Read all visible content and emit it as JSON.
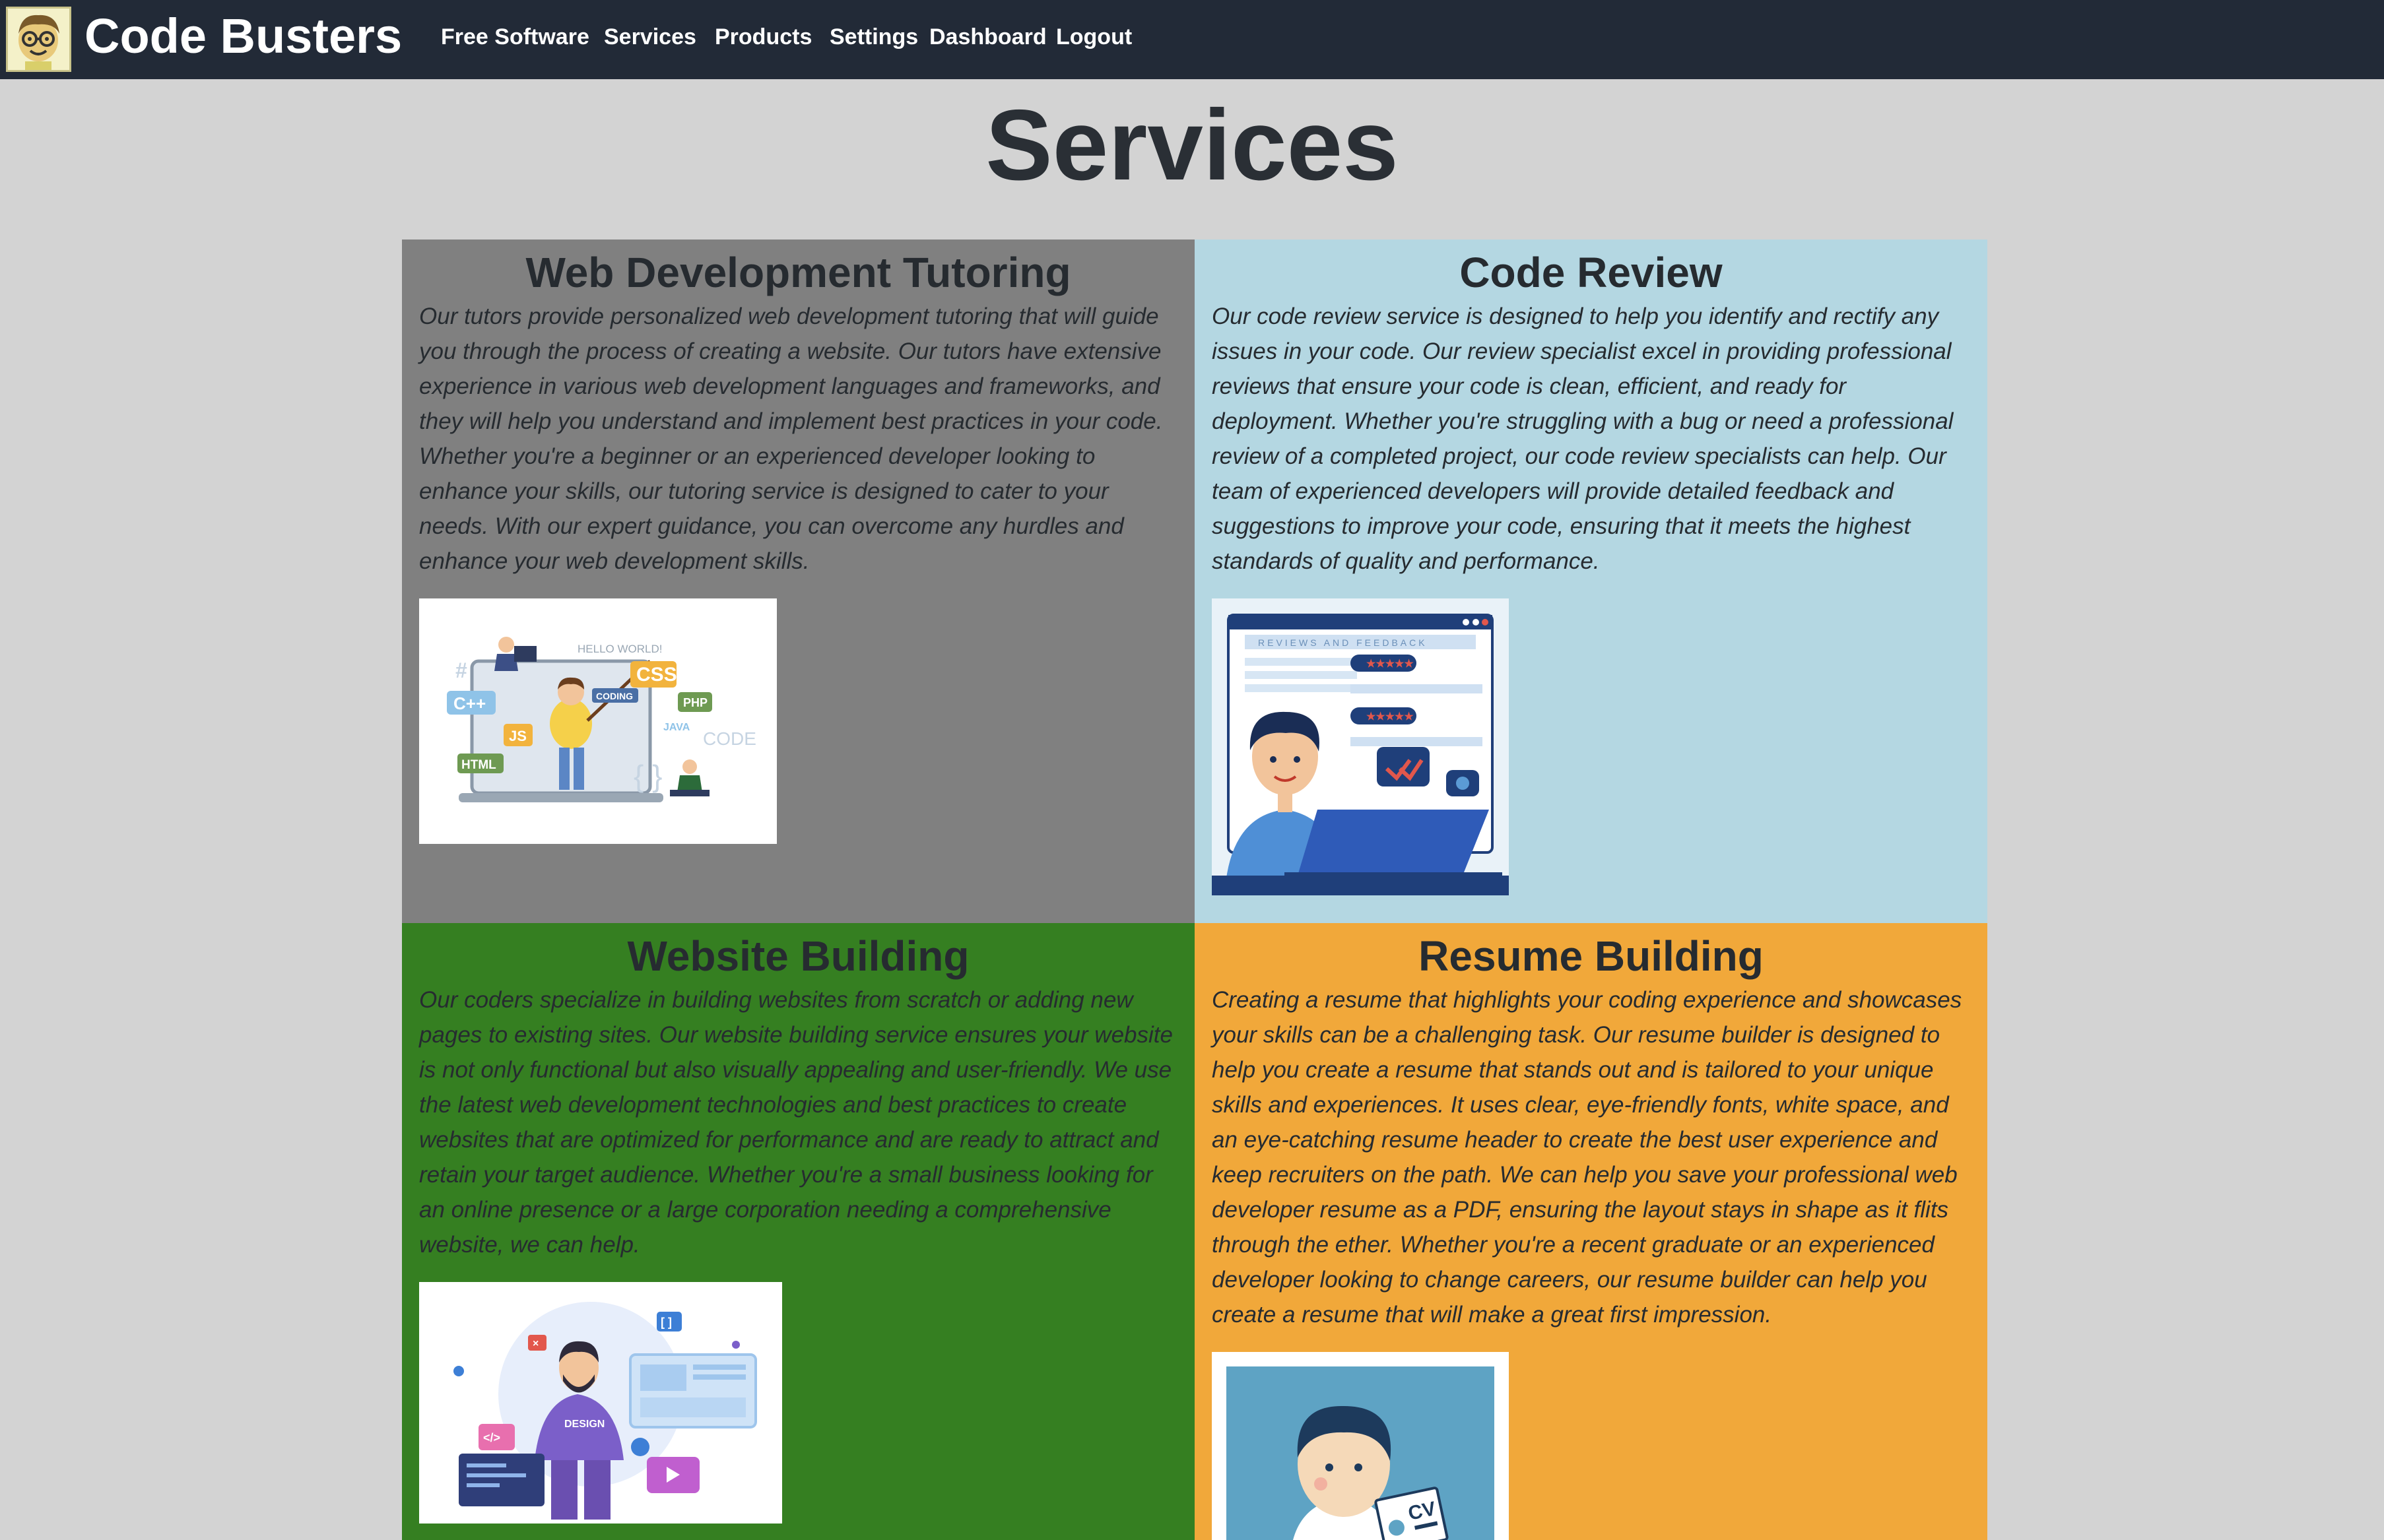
{
  "brand": {
    "name": "Code Busters",
    "logo_icon": "nerd-face-icon"
  },
  "nav": {
    "items": [
      "Free Software",
      "Services",
      "Products",
      "Settings",
      "Dashboard",
      "Logout"
    ]
  },
  "page": {
    "title": "Services"
  },
  "cards": [
    {
      "title": "Web Development Tutoring",
      "text": "Our tutors provide personalized web development tutoring that will guide you through the process of creating a website. Our tutors have extensive experience in various web development languages and frameworks, and they will help you understand and implement best practices in your code. Whether you're a beginner or an experienced developer looking to enhance your skills, our tutoring service is designed to cater to your needs. With our expert guidance, you can overcome any hurdles and enhance your web development skills.",
      "background": "#808080",
      "image_labels": [
        "HELLO WORLD!",
        "C++",
        "CSS",
        "CODING",
        "PHP",
        "JS",
        "JAVA",
        "CODE",
        "HTML",
        "{ }",
        "#"
      ]
    },
    {
      "title": "Code Review",
      "text": "Our code review service is designed to help you identify and rectify any issues in your code. Our review specialist excel in providing professional reviews that ensure your code is clean, efficient, and ready for deployment. Whether you're struggling with a bug or need a professional review of a completed project, our code review specialists can help. Our team of experienced developers will provide detailed feedback and suggestions to improve your code, ensuring that it meets the highest standards of quality and performance.",
      "background": "#b4d7e2",
      "image_labels": [
        "REVIEWS AND FEEDBACK",
        "★★★★★",
        "★★★★★"
      ]
    },
    {
      "title": "Website Building",
      "text": "Our coders specialize in building websites from scratch or adding new pages to existing sites. Our website building service ensures your website is not only functional but also visually appealing and user-friendly. We use the latest web development technologies and best practices to create websites that are optimized for performance and are ready to attract and retain your target audience. Whether you're a small business looking for an online presence or a large corporation needing a comprehensive website, we can help.",
      "background": "#357f21",
      "image_labels": [
        "DESIGN",
        "</>",
        "[ ]"
      ]
    },
    {
      "title": "Resume Building",
      "text": "Creating a resume that highlights your coding experience and showcases your skills can be a challenging task. Our resume builder is designed to help you create a resume that stands out and is tailored to your unique skills and experiences. It uses clear, eye-friendly fonts, white space, and an eye-catching resume header to create the best user experience and keep recruiters on the path. We can help you save your professional web developer resume as a PDF, ensuring the layout stays in shape as it flits through the ether. Whether you're a recent graduate or an experienced developer looking to change careers, our resume builder can help you create a resume that will make a great first impression.",
      "background": "#f1a83a",
      "image_labels": [
        "CV"
      ]
    }
  ]
}
